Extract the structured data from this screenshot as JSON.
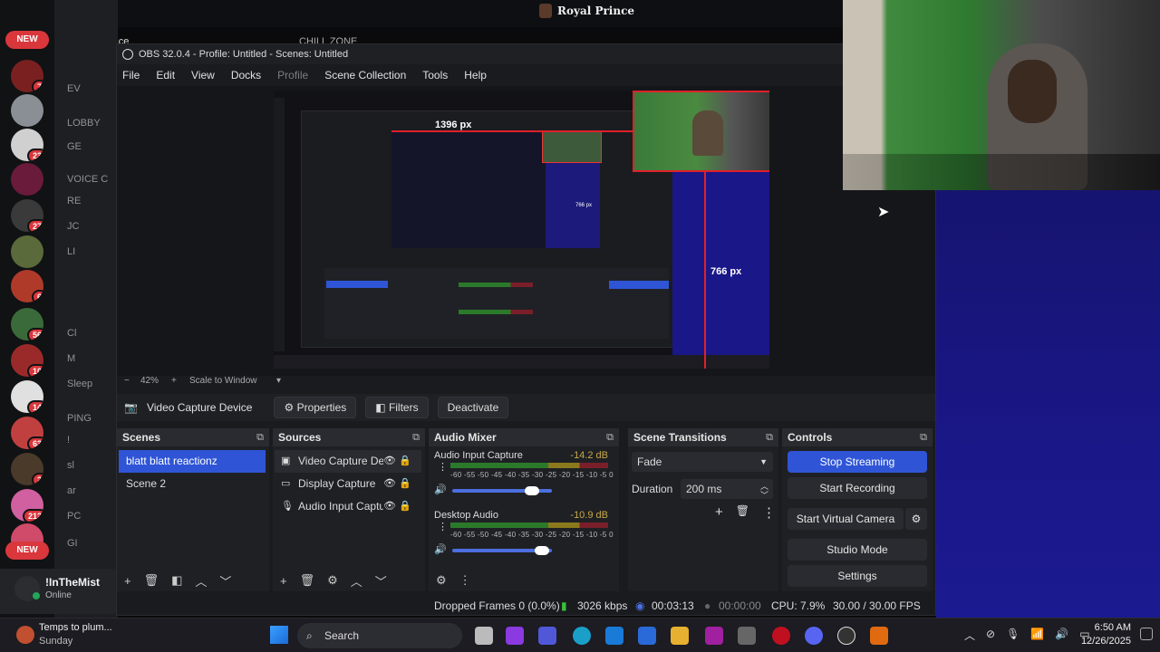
{
  "stream_overlay": {
    "channel_name": "Royal Prince"
  },
  "discord": {
    "new_label_top": "NEW",
    "new_label_bottom": "NEW",
    "server_badges": [
      "7",
      "23",
      "27",
      "6",
      "56",
      "10",
      "14",
      "63",
      "2",
      "212"
    ],
    "channels": [
      "EV",
      "LOBBY",
      "GE",
      "VOICE C",
      "RE",
      "JC",
      "LI",
      "",
      "",
      "Cl",
      "M",
      "Sleep",
      "PING",
      "!",
      "sl",
      "ar",
      "PC",
      "GI"
    ],
    "server_title": "Royal Prince",
    "voice_channel": "CHILL ZONE",
    "user": {
      "name": "!InTheMist",
      "status": "Online"
    }
  },
  "obs": {
    "title": "OBS 32.0.4 - Profile: Untitled - Scenes: Untitled",
    "menu": [
      "File",
      "Edit",
      "View",
      "Docks",
      "Profile",
      "Scene Collection",
      "Tools",
      "Help"
    ],
    "preview": {
      "width_label": "1396 px",
      "height_label": "766 px",
      "inner_height_label": "766 px"
    },
    "zoom": {
      "minus": "−",
      "percent": "42%",
      "plus": "+",
      "mode": "Scale to Window"
    },
    "source_bar": {
      "source_name": "Video Capture Device",
      "properties": "Properties",
      "filters": "Filters",
      "deactivate": "Deactivate"
    },
    "scenes": {
      "title": "Scenes",
      "items": [
        "blatt blatt reactionz",
        "Scene 2"
      ]
    },
    "sources": {
      "title": "Sources",
      "items": [
        "Video Capture Device",
        "Display Capture",
        "Audio Input Capture"
      ]
    },
    "mixer": {
      "title": "Audio Mixer",
      "scale": "-60 -55 -50 -45 -40 -35 -30 -25 -20 -15 -10  -5  0",
      "channels": [
        {
          "name": "Audio Input Capture",
          "db": "-14.2 dB",
          "volume": 0.8
        },
        {
          "name": "Desktop Audio",
          "db": "-10.9 dB",
          "volume": 0.9
        }
      ]
    },
    "transitions": {
      "title": "Scene Transitions",
      "selected": "Fade",
      "duration_label": "Duration",
      "duration_value": "200 ms"
    },
    "controls": {
      "title": "Controls",
      "stop_streaming": "Stop Streaming",
      "start_recording": "Start Recording",
      "start_virtual_camera": "Start Virtual Camera",
      "studio_mode": "Studio Mode",
      "settings": "Settings"
    },
    "status": {
      "dropped_frames": "Dropped Frames 0 (0.0%)",
      "bitrate": "3026 kbps",
      "stream_time": "00:03:13",
      "record_time": "00:00:00",
      "cpu": "CPU: 7.9%",
      "fps": "30.00 / 30.00 FPS"
    }
  },
  "taskbar": {
    "weather_title": "Temps to plum...",
    "weather_sub": "Sunday",
    "search": "Search",
    "time": "6:50 AM",
    "date": "12/26/2025"
  },
  "colors": {
    "accent": "#2f55d6",
    "discord_red": "#da373c",
    "overlay_blue": "#1a1788"
  }
}
